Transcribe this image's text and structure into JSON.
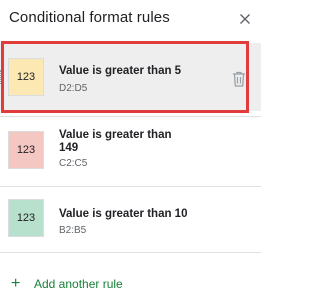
{
  "panel": {
    "title": "Conditional format rules",
    "close_icon": "close-icon"
  },
  "rules": [
    {
      "swatch_text": "123",
      "swatch_color": "#fce8b2",
      "title": "Value is greater than 5",
      "range": "D2:D5",
      "selected": true,
      "delete_icon": "trash-icon"
    },
    {
      "swatch_text": "123",
      "swatch_color": "#f4c7c3",
      "title": "Value is greater than 149",
      "range": "C2:C5",
      "selected": false
    },
    {
      "swatch_text": "123",
      "swatch_color": "#b7e1cd",
      "title": "Value is greater than 10",
      "range": "B2:B5",
      "selected": false
    }
  ],
  "add_rule": {
    "icon": "plus-icon",
    "label": "Add another rule"
  },
  "colors": {
    "accent_green": "#188038",
    "highlight_red": "#e03c3c"
  }
}
